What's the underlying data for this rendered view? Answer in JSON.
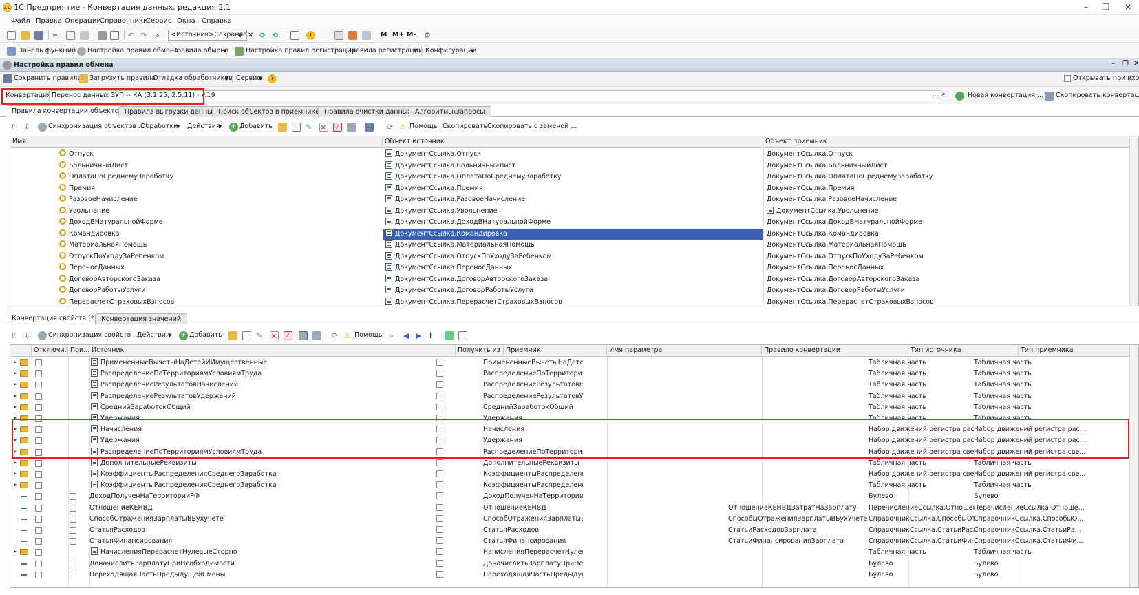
{
  "app": {
    "title": "1С:Предприятие - Конвертация данных, редакция 2.1"
  },
  "menu": [
    "Файл",
    "Правка",
    "Операции",
    "Справочники",
    "Сервис",
    "Окна",
    "Справка"
  ],
  "toolbar1": {
    "source_combo": "<Источник>Сохраняем"
  },
  "toolbar1_letters": [
    "M",
    "M+",
    "M-"
  ],
  "toolbar2": [
    "Панель функций",
    "Настройка правил обмена",
    "Правила обмена",
    "Настройка правил регистрации",
    "Правила регистрации",
    "Конфигурации"
  ],
  "panel": {
    "title": "Настройка правил обмена",
    "save": "Сохранить правила",
    "load": "Загрузить правила",
    "debug": "Отладка обработчиков",
    "service": "Сервис",
    "help_glyph": "?",
    "open_on_start": "Открывать при входе"
  },
  "conversion": {
    "label": "Конвертация:",
    "value": "Перенос данных ЗУП -- КА (3.1.25, 2.5.11) - v.19",
    "new_button": "Новая конвертация ...",
    "copy_button": "Скопировать конвертацию"
  },
  "tabs_top": [
    "Правила конвертации объектов",
    "Правила выгрузки данных",
    "Поиск объектов в приемнике",
    "Правила очистки данных",
    "Алгоритмы\\Запросы"
  ],
  "obj_toolbar": {
    "sync": "Синхронизация объектов ...",
    "handlers": "Обработки",
    "actions": "Действия",
    "add": "Добавить",
    "help": "Помощь",
    "copy": "Скопировать",
    "copy_replace": "Скопировать с заменой ..."
  },
  "obj_table": {
    "columns": [
      "Имя",
      "Объект источник",
      "Объект приемник"
    ],
    "rows": [
      [
        "Отпуск",
        "ДокументСсылка.Отпуск",
        "ДокументСсылка.Отпуск"
      ],
      [
        "БольничныйЛист",
        "ДокументСсылка.БольничныйЛист",
        "ДокументСсылка.БольничныйЛист"
      ],
      [
        "ОплатаПоСреднемуЗаработку",
        "ДокументСсылка.ОплатаПоСреднемуЗаработку",
        "ДокументСсылка.ОплатаПоСреднемуЗаработку"
      ],
      [
        "Премия",
        "ДокументСсылка.Премия",
        "ДокументСсылка.Премия"
      ],
      [
        "РазовоеНачисление",
        "ДокументСсылка.РазовоеНачисление",
        "ДокументСсылка.РазовоеНачисление"
      ],
      [
        "Увольнение",
        "ДокументСсылка.Увольнение",
        "ДокументСсылка.Увольнение"
      ],
      [
        "ДоходВНатуральнойФорме",
        "ДокументСсылка.ДоходВНатуральнойФорме",
        "ДокументСсылка.ДоходВНатуральнойФорме"
      ],
      [
        "Командировка",
        "ДокументСсылка.Командировка",
        "ДокументСсылка.Командировка"
      ],
      [
        "МатериальнаяПомощь",
        "ДокументСсылка.МатериальнаяПомощь",
        "ДокументСсылка.МатериальнаяПомощь"
      ],
      [
        "ОтпускПоУходуЗаРебенком",
        "ДокументСсылка.ОтпускПоУходуЗаРебенком",
        "ДокументСсылка.ОтпускПоУходуЗаРебенком"
      ],
      [
        "ПереносДанных",
        "ДокументСсылка.ПереносДанных",
        "ДокументСсылка.ПереносДанных"
      ],
      [
        "ДоговорАвторскогоЗаказа",
        "ДокументСсылка.ДоговорАвторскогоЗаказа",
        "ДокументСсылка.ДоговорАвторскогоЗаказа"
      ],
      [
        "ДоговорРаботыУслуги",
        "ДокументСсылка.ДоговорРаботыУслуги",
        "ДокументСсылка.ДоговорРаботыУслуги"
      ],
      [
        "ПерерасчетСтраховыхВзносов",
        "ДокументСсылка.ПерерасчетСтраховыхВзносов",
        "ДокументСсылка.ПерерасчетСтраховыхВзносов"
      ]
    ]
  },
  "tabs_bottom": [
    "Конвертация свойств (*)",
    "Конвертация значений"
  ],
  "prop_toolbar": {
    "sync": "Синхронизация свойств ...",
    "actions": "Действия",
    "add": "Добавить",
    "help": "Помощь"
  },
  "prop_table": {
    "columns": [
      "Отключи...",
      "Пои...",
      "Источник",
      "Получить из ...",
      "Приемник",
      "Имя параметра",
      "Правило конвертации",
      "Тип источника",
      "Тип приемника"
    ],
    "rows": [
      {
        "kind": "group",
        "src": "ПримененныеВычетыНаДетейИИмущественные",
        "dst": "ПримененныеВычетыНаДетей...",
        "rule": "",
        "st": "Табличная часть",
        "dt": "Табличная часть"
      },
      {
        "kind": "group",
        "src": "РаспределениеПоТерриториямУсловиямТруда",
        "dst": "РаспределениеПоТерритория...",
        "rule": "",
        "st": "Табличная часть",
        "dt": "Табличная часть"
      },
      {
        "kind": "group",
        "src": "РаспределениеРезультатовНачислений",
        "dst": "РаспределениеРезультатовНа...",
        "rule": "",
        "st": "Табличная часть",
        "dt": "Табличная часть"
      },
      {
        "kind": "group",
        "src": "РаспределениеРезультатовУдержаний",
        "dst": "РаспределениеРезультатовУд...",
        "rule": "",
        "st": "Табличная часть",
        "dt": "Табличная часть"
      },
      {
        "kind": "group",
        "src": "СреднийЗаработокОбщий",
        "dst": "СреднийЗаработокОбщий",
        "rule": "",
        "st": "Табличная часть",
        "dt": "Табличная часть"
      },
      {
        "kind": "group",
        "src": "Удержания",
        "dst": "Удержания",
        "rule": "",
        "st": "Табличная часть",
        "dt": "Табличная часть"
      },
      {
        "kind": "group",
        "src": "Начисления",
        "dst": "Начисления",
        "rule": "",
        "st": "Набор движений регистра расчета",
        "dt": "Набор движений регистра рас..."
      },
      {
        "kind": "group",
        "src": "Удержания",
        "dst": "Удержания",
        "rule": "",
        "st": "Набор движений регистра расчета",
        "dt": "Набор движений регистра рас..."
      },
      {
        "kind": "group",
        "src": "РаспределениеПоТерриториямУсловиямТруда",
        "dst": "РаспределениеПоТерритория...",
        "rule": "",
        "st": "Набор движений регистра сведе...",
        "dt": "Набор движений регистра све..."
      },
      {
        "kind": "group",
        "src": "ДополнительныеРеквизиты",
        "dst": "ДополнительныеРеквизиты",
        "rule": "",
        "st": "Табличная часть",
        "dt": "Табличная часть"
      },
      {
        "kind": "group",
        "src": "КоэффициентыРаспределенияСреднегоЗаработка",
        "dst": "КоэффициентыРаспределения...",
        "rule": "",
        "st": "Набор движений регистра сведе...",
        "dt": "Набор движений регистра све..."
      },
      {
        "kind": "group",
        "src": "КоэффициентыРаспределенияСреднегоЗаработка",
        "dst": "КоэффициентыРаспределения...",
        "rule": "",
        "st": "Табличная часть",
        "dt": "Табличная часть"
      },
      {
        "kind": "prop",
        "src": "ДоходПолученНаТерриторииРФ",
        "dst": "ДоходПолученНаТерриторииР...",
        "rule": "",
        "st": "Булево",
        "dt": "Булево"
      },
      {
        "kind": "prop",
        "src": "ОтношениеКЕНВД",
        "dst": "ОтношениеКЕНВД",
        "rule": "ОтношениеКЕНВДЗатратНаЗарплату",
        "st": "ПеречислениеСсылка.Отношени...",
        "dt": "ПеречислениеСсылка.Отноше..."
      },
      {
        "kind": "prop",
        "src": "СпособОтраженияЗарплатыВБухучете",
        "dst": "СпособОтраженияЗарплатыВБ...",
        "rule": "СпособыОтраженияЗарплатыВБухУчете",
        "st": "СправочникСсылка.СпособыОтр...",
        "dt": "СправочникСсылка.СпособыО..."
      },
      {
        "kind": "prop",
        "src": "СтатьяРасходов",
        "dst": "СтатьяРасходов",
        "rule": "СтатьиРасходовЗарплата",
        "st": "СправочникСсылка.СтатьиРасх...",
        "dt": "СправочникСсылка.СтатьиРа..."
      },
      {
        "kind": "prop",
        "src": "СтатьяФинансирования",
        "dst": "СтатьяФинансирования",
        "rule": "СтатьиФинансированияЗарплата",
        "st": "СправочникСсылка.СтатьиФина...",
        "dt": "СправочникСсылка.СтатьиФи..."
      },
      {
        "kind": "group",
        "src": "НачисленияПерерасчетНулевыеСторно",
        "dst": "НачисленияПерерасчетНулев...",
        "rule": "",
        "st": "Табличная часть",
        "dt": "Табличная часть"
      },
      {
        "kind": "prop",
        "src": "ДоначислитьЗарплатуПриНеобходимости",
        "dst": "ДоначислитьЗарплатуПриНео...",
        "rule": "",
        "st": "Булево",
        "dt": "Булево"
      },
      {
        "kind": "prop",
        "src": "ПереходящаяЧастьПредыдущейСмены",
        "dst": "ПереходящаяЧастьПредыдущ...",
        "rule": "",
        "st": "Булево",
        "dt": "Булево"
      }
    ]
  }
}
